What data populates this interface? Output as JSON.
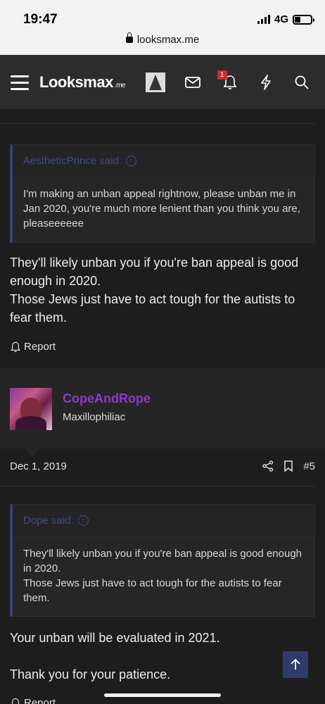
{
  "status_bar": {
    "time": "19:47",
    "network": "4G"
  },
  "url_bar": {
    "domain": "looksmax.me"
  },
  "navbar": {
    "logo_text": "Looksmax",
    "logo_suffix": ".me",
    "alerts_count": "1"
  },
  "post1": {
    "quote_author": "AestheticPrince said:",
    "quote_text": "I'm making an unban appeal rightnow, please unban me in Jan 2020, you're much more lenient than you think you are, pleaseeeeee",
    "body": "They'll likely unban you if you're ban appeal is good enough in 2020.\nThose Jews just have to act tough for the autists to fear them.",
    "report_label": "Report"
  },
  "post2": {
    "username": "CopeAndRope",
    "user_title": "Maxillophiliac",
    "date": "Dec 1, 2019",
    "post_number": "#5",
    "quote_author": "Dope said:",
    "quote_text": "They'll likely unban you if you're ban appeal is good enough in 2020.\nThose Jews just have to act tough for the autists to fear them.",
    "body": "Your unban will be evaluated in 2021.\n\nThank you for your patience.",
    "report_label": "Report"
  },
  "colors": {
    "username": "#8c3ac9",
    "quote_accent": "#3d4c8a",
    "background": "#1d1d1d",
    "navbar": "#2c2c2c"
  }
}
